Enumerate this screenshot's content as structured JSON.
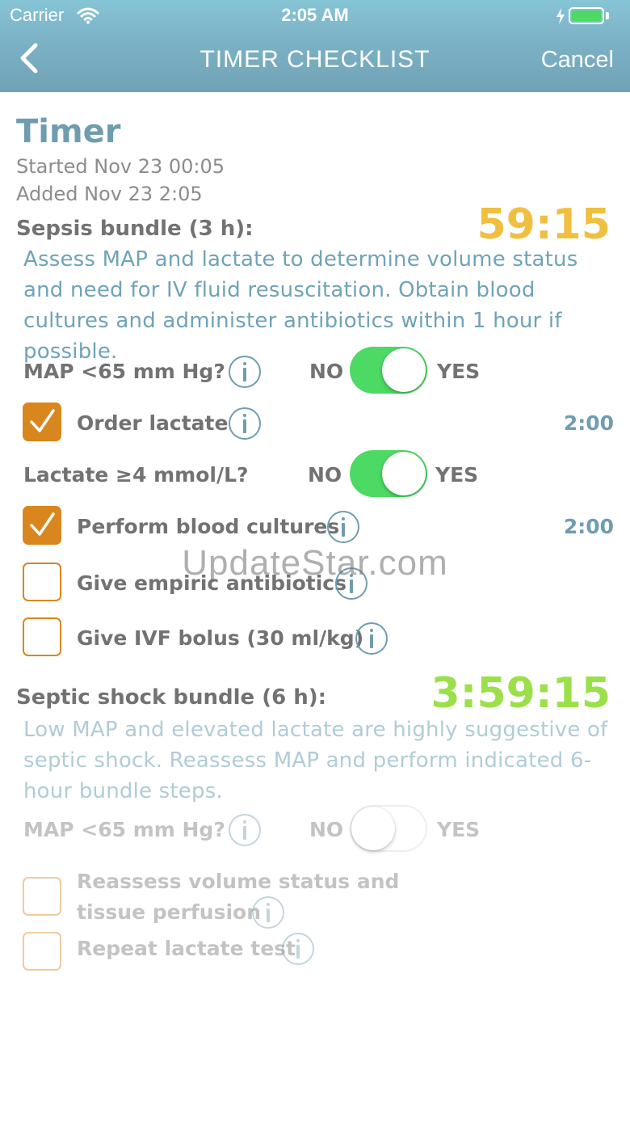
{
  "status_bar": {
    "carrier": "Carrier",
    "time": "2:05 AM",
    "battery_level": 1.0
  },
  "nav": {
    "title": "TIMER CHECKLIST",
    "cancel_label": "Cancel"
  },
  "timer": {
    "title": "Timer",
    "started": "Started Nov 23 00:05",
    "added": "Added Nov 23 2:05"
  },
  "sepsis_bundle": {
    "title": "Sepsis bundle (3 h):",
    "countdown": "59:15",
    "description": "Assess MAP and lactate to determine volume status and need for IV fluid resuscitation. Obtain blood cultures and administer antibiotics within 1 hour if possible.",
    "map_question": {
      "label": "MAP <65 mm Hg?",
      "no": "NO",
      "yes": "YES",
      "value": true
    },
    "lactate_question": {
      "label": "Lactate ≥4 mmol/L?",
      "no": "NO",
      "yes": "YES",
      "value": true
    },
    "items": [
      {
        "label": "Order lactate",
        "checked": true,
        "time": "2:00"
      },
      {
        "label": "Perform blood cultures",
        "checked": true,
        "time": "2:00"
      },
      {
        "label": "Give empiric antibiotics",
        "checked": false,
        "time": ""
      },
      {
        "label": "Give IVF bolus (30 ml/kg)",
        "checked": false,
        "time": ""
      }
    ]
  },
  "septic_shock_bundle": {
    "title": "Septic shock bundle (6 h):",
    "countdown": "3:59:15",
    "description": "Low MAP and elevated lactate are highly suggestive of septic shock. Reassess MAP and perform indicated 6-hour bundle steps.",
    "map_question": {
      "label": "MAP <65 mm Hg?",
      "no": "NO",
      "yes": "YES",
      "value": false
    },
    "items": [
      {
        "label_line1": "Reassess volume status and",
        "label_line2": "tissue perfusion",
        "checked": false
      },
      {
        "label": "Repeat lactate test",
        "checked": false
      }
    ]
  },
  "watermark": "UpdateStar.com",
  "colors": {
    "accent_teal": "#6f9db0",
    "accent_orange": "#d9861f",
    "timer_yellow": "#f0bf3f",
    "timer_green": "#9be04a",
    "toggle_green": "#4cd964",
    "description_teal": "#6fa3b8"
  }
}
